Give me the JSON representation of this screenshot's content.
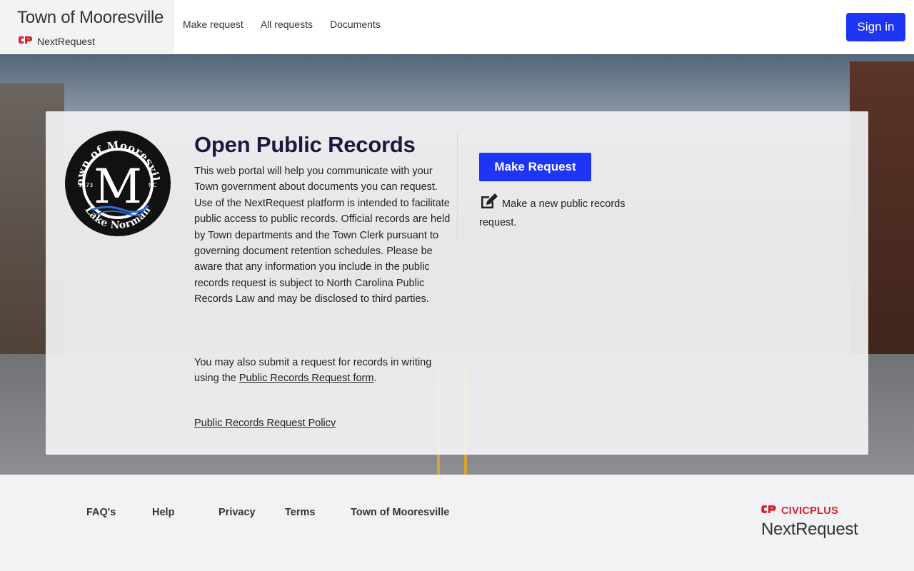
{
  "header": {
    "site_title": "Town of Mooresville",
    "brand_sub": "NextRequest",
    "nav": [
      "Make request",
      "All requests",
      "Documents"
    ],
    "signin_label": "Sign in"
  },
  "seal": {
    "top_text": "Town of Mooresville",
    "letter": "M",
    "year": "1873",
    "state": "NC",
    "bottom_text": "Lake Norman"
  },
  "card": {
    "title": "Open Public Records",
    "body": "This web portal will help you communicate with your Town government about documents you can request. Use of the NextRequest platform is intended to facilitate public access to public records. Official records are held by Town departments and the Town Clerk pursuant to governing document retention schedules. Please be aware that any information you include in the public records request is subject to North Carolina Public Records Law and may be disclosed to third parties.",
    "body2_prefix": "You may also submit a request for records in writing using the ",
    "body2_link": "Public Records Request form",
    "body2_suffix": ".",
    "policy_link": "Public Records Request Policy",
    "make_button": "Make Request",
    "make_desc": "Make a new public records request."
  },
  "footer": {
    "links": [
      "FAQ's",
      "Help",
      "Privacy",
      "Terms",
      "Town of Mooresville"
    ],
    "civic_brand": "CIVICPLUS",
    "civic_product": "NextRequest"
  },
  "colors": {
    "accent": "#1e35f5",
    "civic_red": "#d2202f"
  }
}
